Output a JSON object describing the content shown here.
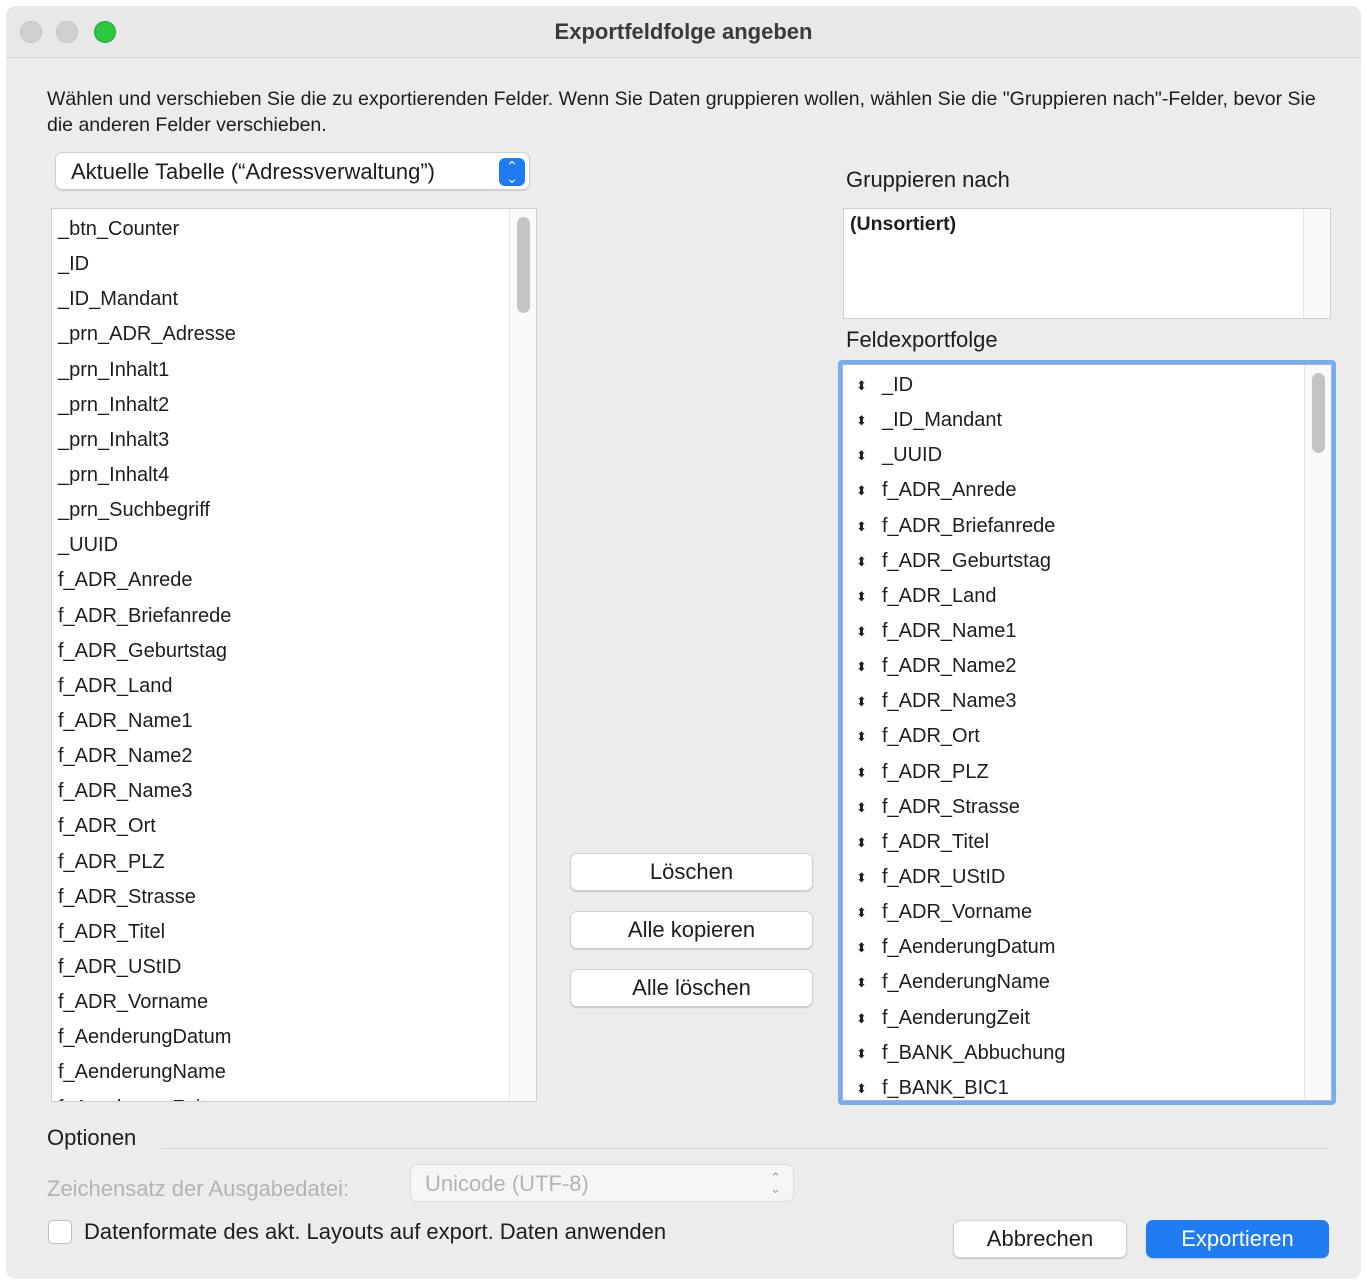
{
  "window": {
    "title": "Exportfeldfolge angeben"
  },
  "instructions": "Wählen und verschieben Sie die zu exportierenden Felder.  Wenn Sie Daten gruppieren wollen, wählen Sie die \"Gruppieren nach\"-Felder, bevor Sie die anderen Felder verschieben.",
  "table_select": {
    "value": "Aktuelle Tabelle (“Adressverwaltung”)"
  },
  "source_fields": [
    "_btn_Counter",
    "_ID",
    "_ID_Mandant",
    "_prn_ADR_Adresse",
    "_prn_Inhalt1",
    "_prn_Inhalt2",
    "_prn_Inhalt3",
    "_prn_Inhalt4",
    "_prn_Suchbegriff",
    "_UUID",
    "f_ADR_Anrede",
    "f_ADR_Briefanrede",
    "f_ADR_Geburtstag",
    "f_ADR_Land",
    "f_ADR_Name1",
    "f_ADR_Name2",
    "f_ADR_Name3",
    "f_ADR_Ort",
    "f_ADR_PLZ",
    "f_ADR_Strasse",
    "f_ADR_Titel",
    "f_ADR_UStID",
    "f_ADR_Vorname",
    "f_AenderungDatum",
    "f_AenderungName",
    "f_AenderungZeit"
  ],
  "group_by": {
    "label": "Gruppieren nach",
    "items": [
      "(Unsortiert)"
    ]
  },
  "export_order": {
    "label": "Feldexportfolge",
    "items": [
      "_ID",
      "_ID_Mandant",
      "_UUID",
      "f_ADR_Anrede",
      "f_ADR_Briefanrede",
      "f_ADR_Geburtstag",
      "f_ADR_Land",
      "f_ADR_Name1",
      "f_ADR_Name2",
      "f_ADR_Name3",
      "f_ADR_Ort",
      "f_ADR_PLZ",
      "f_ADR_Strasse",
      "f_ADR_Titel",
      "f_ADR_UStID",
      "f_ADR_Vorname",
      "f_AenderungDatum",
      "f_AenderungName",
      "f_AenderungZeit",
      "f_BANK_Abbuchung",
      "f_BANK_BIC1"
    ]
  },
  "buttons": {
    "delete": "Löschen",
    "copy_all": "Alle kopieren",
    "delete_all": "Alle löschen",
    "cancel": "Abbrechen",
    "export": "Exportieren"
  },
  "options": {
    "title": "Optionen",
    "charset_label": "Zeichensatz der Ausgabedatei:",
    "charset_value": "Unicode (UTF-8)",
    "apply_formats_label": "Datenformate des akt. Layouts auf export. Daten anwenden",
    "apply_formats_checked": false
  },
  "colors": {
    "accent": "#1f7cf2",
    "focus_ring": "#7aabf0",
    "window_bg": "#ececec",
    "zoom_button": "#2bc840"
  },
  "icons": {
    "move_handle": "reorder-arrows-icon",
    "popup_stepper": "up-down-chevron-icon"
  }
}
